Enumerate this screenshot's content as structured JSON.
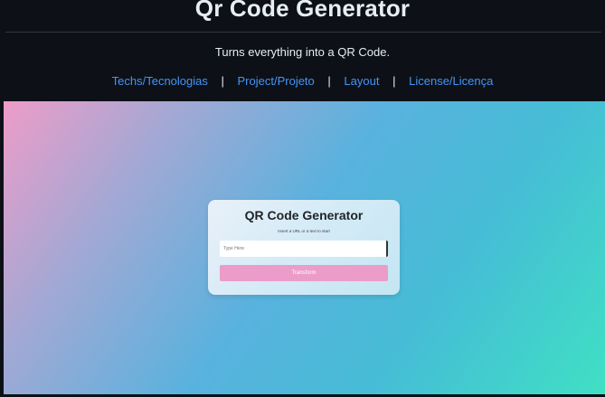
{
  "readme": {
    "title": "Qr Code Generator",
    "subtitle": "Turns everything into a QR Code.",
    "nav": [
      {
        "label": "Techs/Tecnologias"
      },
      {
        "label": "Project/Projeto"
      },
      {
        "label": "Layout"
      },
      {
        "label": "License/Licença"
      }
    ],
    "separator": "|"
  },
  "preview": {
    "gradient_colors": [
      "#ee9cc8",
      "#a3a8d4",
      "#59b2de",
      "#46bcd6",
      "#3fe0c4"
    ],
    "card": {
      "title": "QR Code Generator",
      "hint": "Insert a URL or a text to start",
      "input_placeholder": "Type Here",
      "input_value": "",
      "button_label": "Transform",
      "button_color": "#ec9cc8"
    }
  },
  "theme": {
    "background": "#0d1117",
    "link_color": "#4493f8",
    "text_color": "#e6edf3"
  }
}
